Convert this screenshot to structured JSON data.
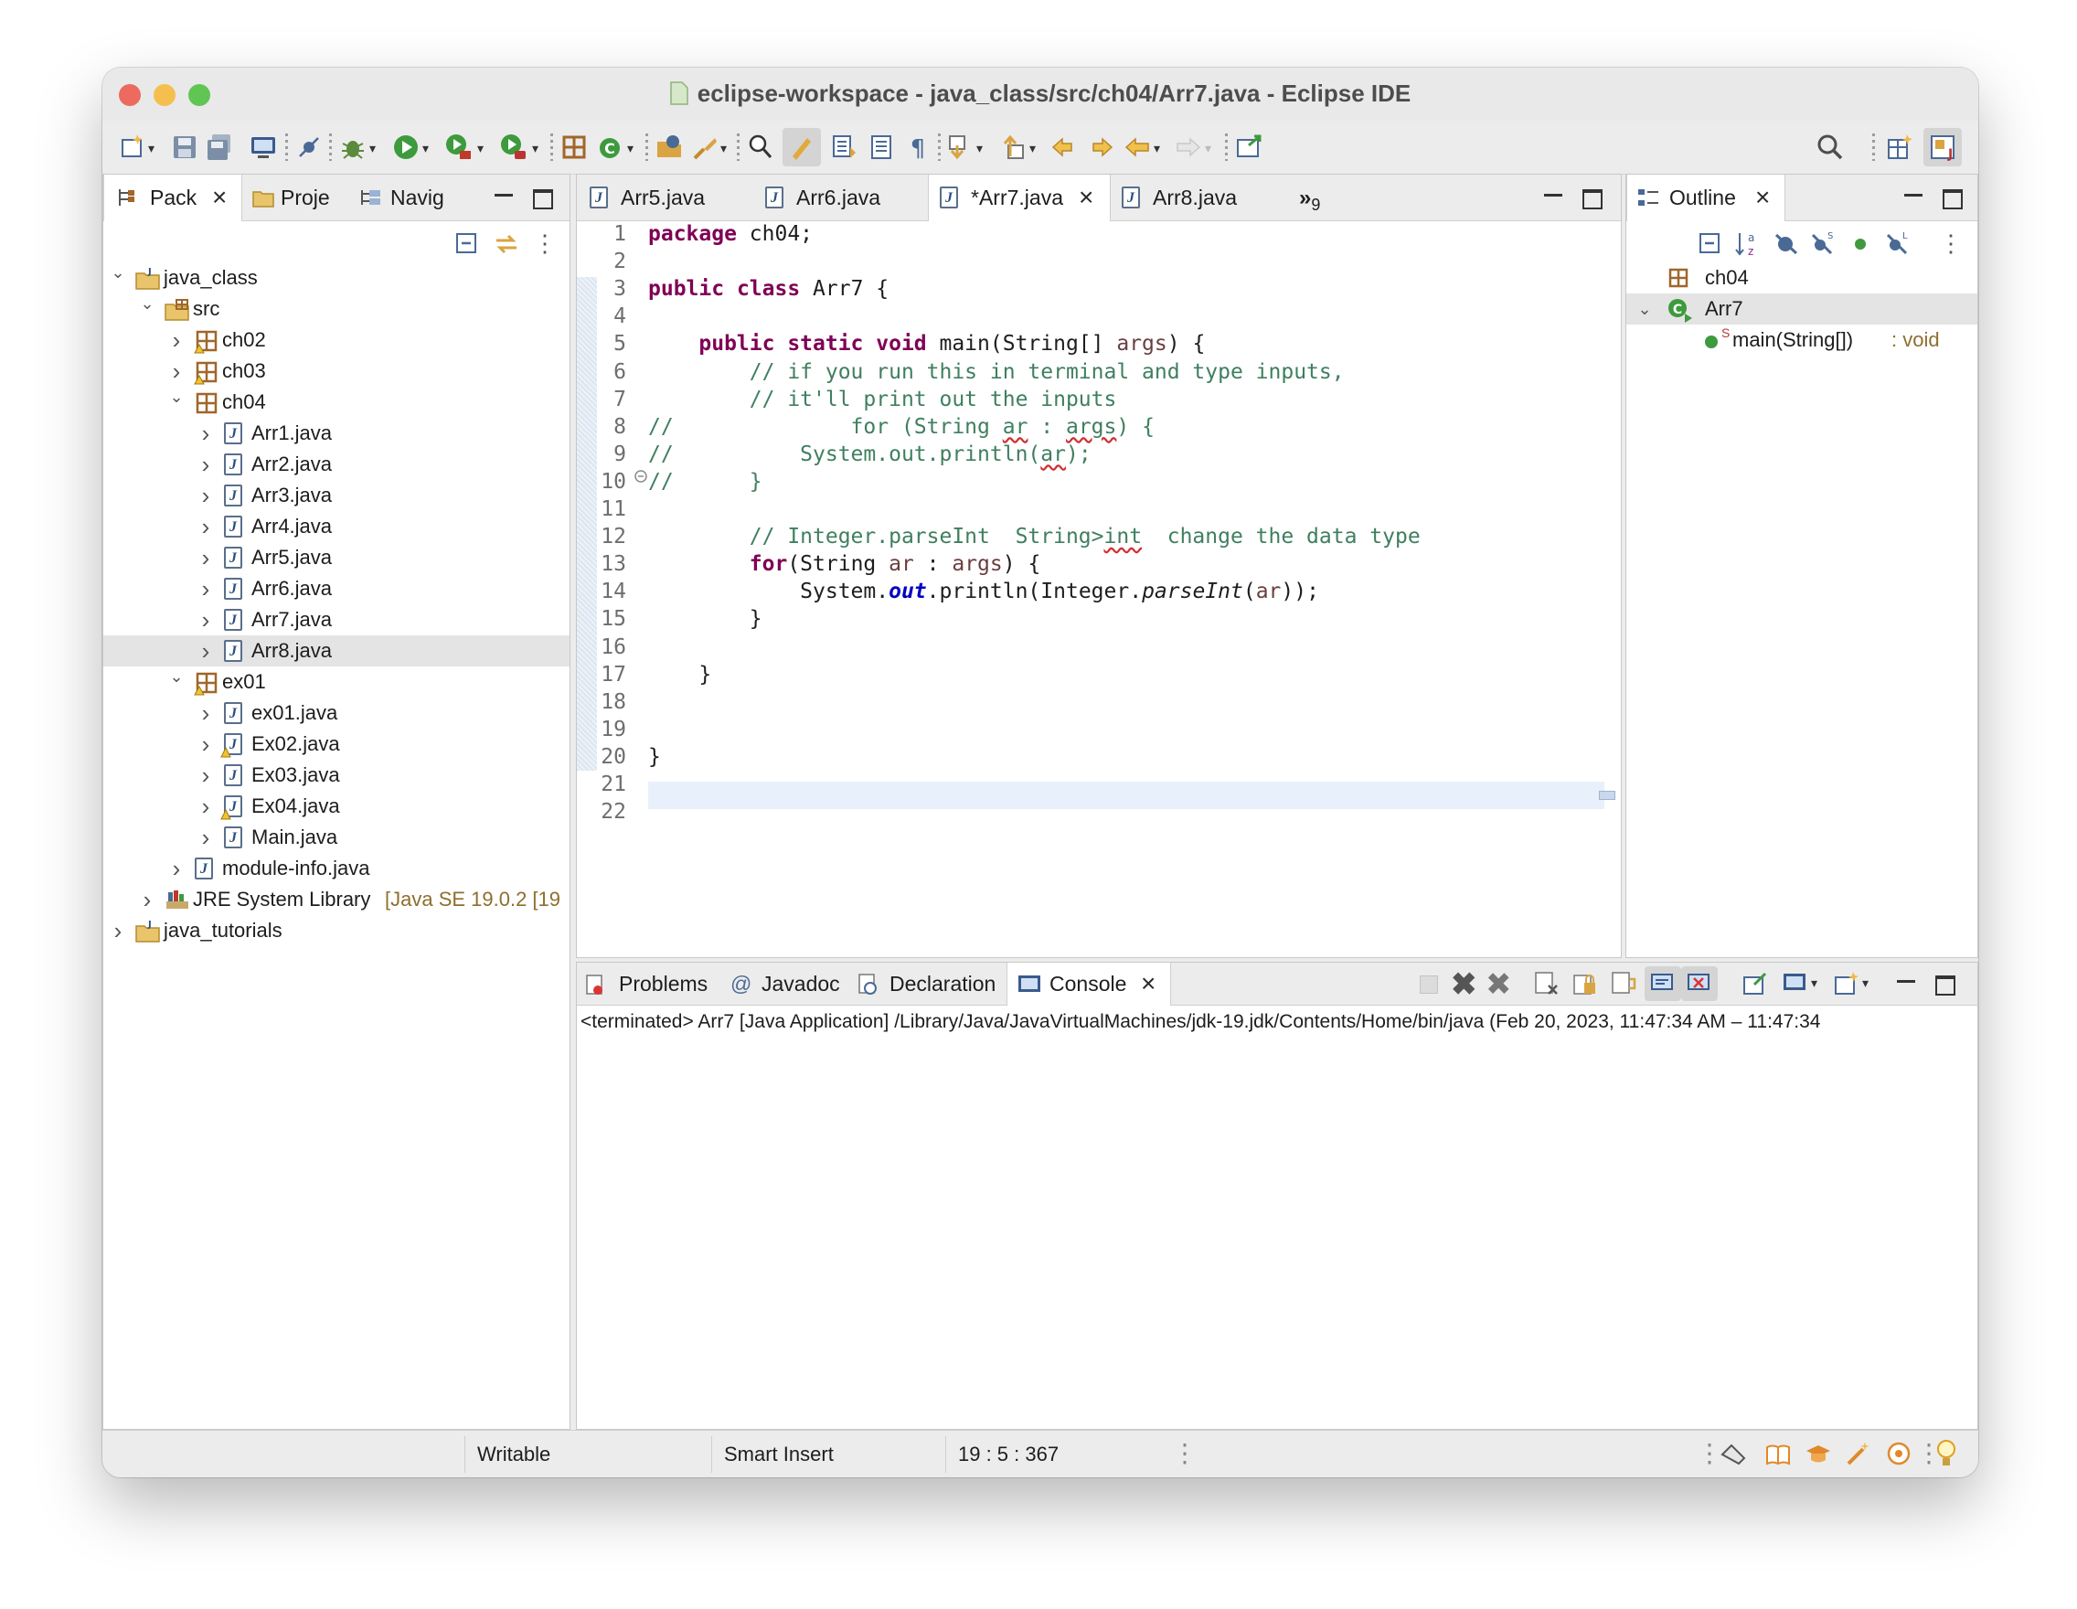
{
  "window": {
    "title": "eclipse-workspace - java_class/src/ch04/Arr7.java - Eclipse IDE"
  },
  "colors": {
    "close": "#ed6a5e",
    "minimize": "#f5bf4f",
    "zoom": "#61c554",
    "keyword": "#7f0055",
    "comment": "#3f7f5f",
    "static_field": "#0000c0",
    "selection": "#e4e4e4"
  },
  "left_panel": {
    "tabs": [
      {
        "label": "Pack",
        "icon": "package-explorer-icon"
      },
      {
        "label": "Proje",
        "icon": "project-explorer-icon"
      },
      {
        "label": "Navig",
        "icon": "navigator-icon"
      }
    ],
    "tree": [
      {
        "label": "java_class",
        "extra": ""
      },
      {
        "label": "src",
        "extra": ""
      },
      {
        "label": "ch02",
        "extra": ""
      },
      {
        "label": "ch03",
        "extra": ""
      },
      {
        "label": "ch04",
        "extra": ""
      },
      {
        "label": "Arr1.java",
        "extra": ""
      },
      {
        "label": "Arr2.java",
        "extra": ""
      },
      {
        "label": "Arr3.java",
        "extra": ""
      },
      {
        "label": "Arr4.java",
        "extra": ""
      },
      {
        "label": "Arr5.java",
        "extra": ""
      },
      {
        "label": "Arr6.java",
        "extra": ""
      },
      {
        "label": "Arr7.java",
        "extra": ""
      },
      {
        "label": "Arr8.java",
        "extra": ""
      },
      {
        "label": "ex01",
        "extra": ""
      },
      {
        "label": "ex01.java",
        "extra": ""
      },
      {
        "label": "Ex02.java",
        "extra": ""
      },
      {
        "label": "Ex03.java",
        "extra": ""
      },
      {
        "label": "Ex04.java",
        "extra": ""
      },
      {
        "label": "Main.java",
        "extra": ""
      },
      {
        "label": "module-info.java",
        "extra": ""
      },
      {
        "label": "JRE System Library",
        "extra": "[Java SE 19.0.2 [19"
      },
      {
        "label": "java_tutorials",
        "extra": ""
      }
    ]
  },
  "editor": {
    "tabs": [
      "Arr5.java",
      "Arr6.java",
      "*Arr7.java",
      "Arr8.java"
    ],
    "overflow": "»",
    "overflow_count": "9",
    "line_numbers": [
      "1",
      "2",
      "3",
      "4",
      "5",
      "6",
      "7",
      "8",
      "9",
      "10",
      "11",
      "12",
      "13",
      "14",
      "15",
      "16",
      "17",
      "18",
      "19",
      "20",
      "21",
      "22"
    ],
    "code": {
      "l1_kw": "package",
      "l1_rest": " ch04;",
      "l3_kw1": "public",
      "l3_kw2": "class",
      "l3_rest": " Arr7 {",
      "l5_kw": "public static void",
      "l5_a": " main(String[] ",
      "l5_args": "args",
      "l5_b": ") {",
      "l6": "        // if you run this in terminal and type inputs,",
      "l7": "        // it'll print out the inputs",
      "l8_a": "//              for (String ",
      "l8_ar": "ar",
      "l8_b": " : ",
      "l8_args": "args",
      "l8_c": ") {",
      "l9_a": "//          System.out.println(",
      "l9_ar": "ar",
      "l9_b": ");",
      "l10": "//      }",
      "l12_a": "        // Integer.parseInt  String>",
      "l12_int": "int",
      "l12_b": "  change the data type",
      "l13_kw": "for",
      "l13_a": "(String ",
      "l13_ar": "ar",
      "l13_b": " : ",
      "l13_args": "args",
      "l13_c": ") {",
      "l14_a": "            System.",
      "l14_out": "out",
      "l14_b": ".println(Integer.",
      "l14_parse": "parseInt",
      "l14_c": "(",
      "l14_ar": "ar",
      "l14_d": "));",
      "l15": "        }",
      "l17": "    }",
      "l20": "}"
    }
  },
  "outline": {
    "tab": "Outline",
    "items": [
      {
        "label": "ch04",
        "suffix": ""
      },
      {
        "label": "Arr7",
        "suffix": ""
      },
      {
        "label": "main(String[])",
        "suffix": " : void",
        "modifier": "S"
      }
    ]
  },
  "bottom_panel": {
    "tabs": [
      {
        "label": "Problems",
        "icon": "problems-icon"
      },
      {
        "label": "Javadoc",
        "icon": "at-icon"
      },
      {
        "label": "Declaration",
        "icon": "declaration-icon"
      },
      {
        "label": "Console",
        "icon": "console-icon"
      }
    ],
    "at_glyph": "@",
    "console_header": "<terminated> Arr7 [Java Application] /Library/Java/JavaVirtualMachines/jdk-19.jdk/Contents/Home/bin/java  (Feb 20, 2023, 11:47:34 AM – 11:47:34"
  },
  "status": {
    "writable": "Writable",
    "insert_mode": "Smart Insert",
    "position": "19 : 5 : 367"
  }
}
